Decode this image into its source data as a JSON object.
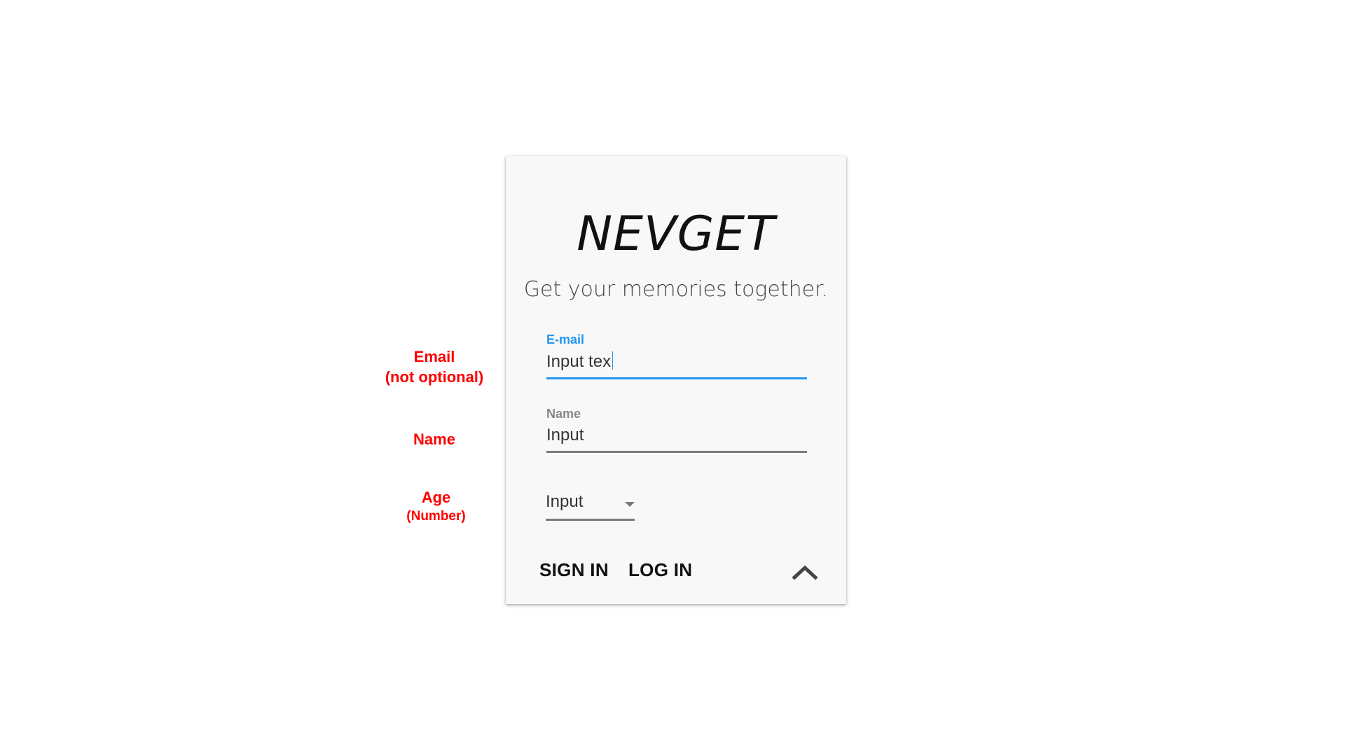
{
  "annotations": {
    "email": {
      "line1": "Email",
      "line2": "(not optional)"
    },
    "name": {
      "line1": "Name"
    },
    "age": {
      "line1": "Age",
      "line2": "(Number)"
    }
  },
  "card": {
    "logo": "NEVGET",
    "tagline": "Get your memories together."
  },
  "form": {
    "email": {
      "label": "E-mail",
      "value": "Input tex"
    },
    "name": {
      "label": "Name",
      "value": "Input"
    },
    "age": {
      "value": "Input"
    }
  },
  "actions": {
    "sign_in": "SIGN IN",
    "log_in": "LOG IN"
  },
  "icons": {
    "dropdown": "caret-down-icon",
    "collapse": "chevron-up-icon"
  },
  "colors": {
    "accent": "#2196f3",
    "annotation": "#ff0000",
    "card_background": "#f8f8f8"
  }
}
